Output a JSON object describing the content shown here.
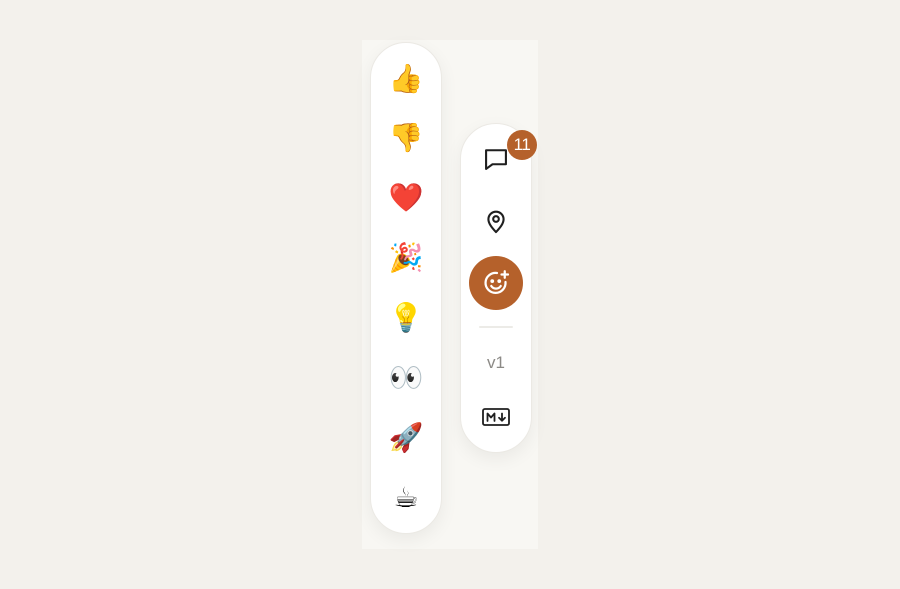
{
  "reactions": {
    "items": [
      {
        "name": "thumbs-up",
        "glyph": "👍"
      },
      {
        "name": "thumbs-down",
        "glyph": "👎"
      },
      {
        "name": "heart",
        "glyph": "❤️"
      },
      {
        "name": "party-popper",
        "glyph": "🎉"
      },
      {
        "name": "light-bulb",
        "glyph": "💡"
      },
      {
        "name": "eyes",
        "glyph": "👀"
      },
      {
        "name": "rocket",
        "glyph": "🚀"
      },
      {
        "name": "hot-beverage",
        "glyph": "☕"
      }
    ]
  },
  "toolbar": {
    "comments_badge": "11",
    "version_label": "v1",
    "icons": {
      "comments": "speech-bubble-icon",
      "location": "map-pin-icon",
      "reaction": "smiley-plus-icon",
      "markdown": "markdown-icon"
    }
  },
  "colors": {
    "accent": "#b5612b",
    "background": "#f3f1ec",
    "panel": "#ffffff",
    "icon": "#1f1f1f",
    "muted": "#8c8a86"
  }
}
